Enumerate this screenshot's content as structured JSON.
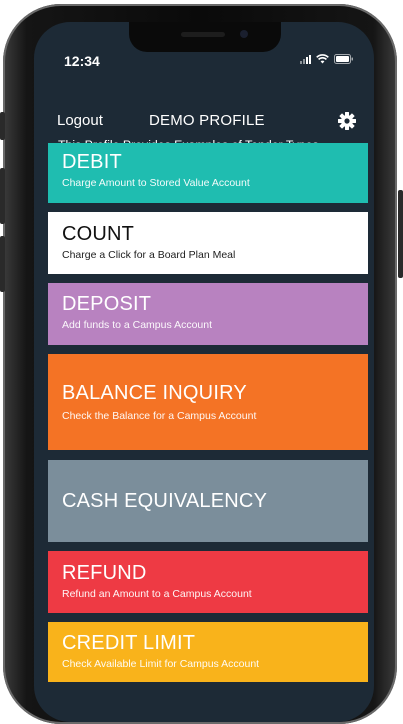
{
  "status_bar": {
    "time": "12:34"
  },
  "header": {
    "logout_label": "Logout",
    "title": "DEMO PROFILE",
    "subtitle": "This Profile Provides Examples of Tender Types",
    "settings_icon": "gear-icon"
  },
  "tiles": [
    {
      "title": "DEBIT",
      "description": "Charge Amount to Stored Value Account",
      "color": "#1fbdb0",
      "text_color": "#ffffff"
    },
    {
      "title": "COUNT",
      "description": "Charge a Click for a Board Plan Meal",
      "color": "#ffffff",
      "text_color": "#111111"
    },
    {
      "title": "DEPOSIT",
      "description": "Add funds to a Campus Account",
      "color": "#b882c0",
      "text_color": "#ffffff"
    },
    {
      "title": "BALANCE INQUIRY",
      "description": "Check the Balance for a Campus Account",
      "color": "#f47325",
      "text_color": "#ffffff"
    },
    {
      "title": "CASH EQUIVALENCY",
      "description": "",
      "color": "#7b8e9b",
      "text_color": "#ffffff"
    },
    {
      "title": "REFUND",
      "description": "Refund an Amount to a Campus Account",
      "color": "#ee3a44",
      "text_color": "#ffffff"
    },
    {
      "title": "CREDIT LIMIT",
      "description": "Check Available Limit for Campus Account",
      "color": "#f9b31b",
      "text_color": "#ffffff"
    }
  ]
}
